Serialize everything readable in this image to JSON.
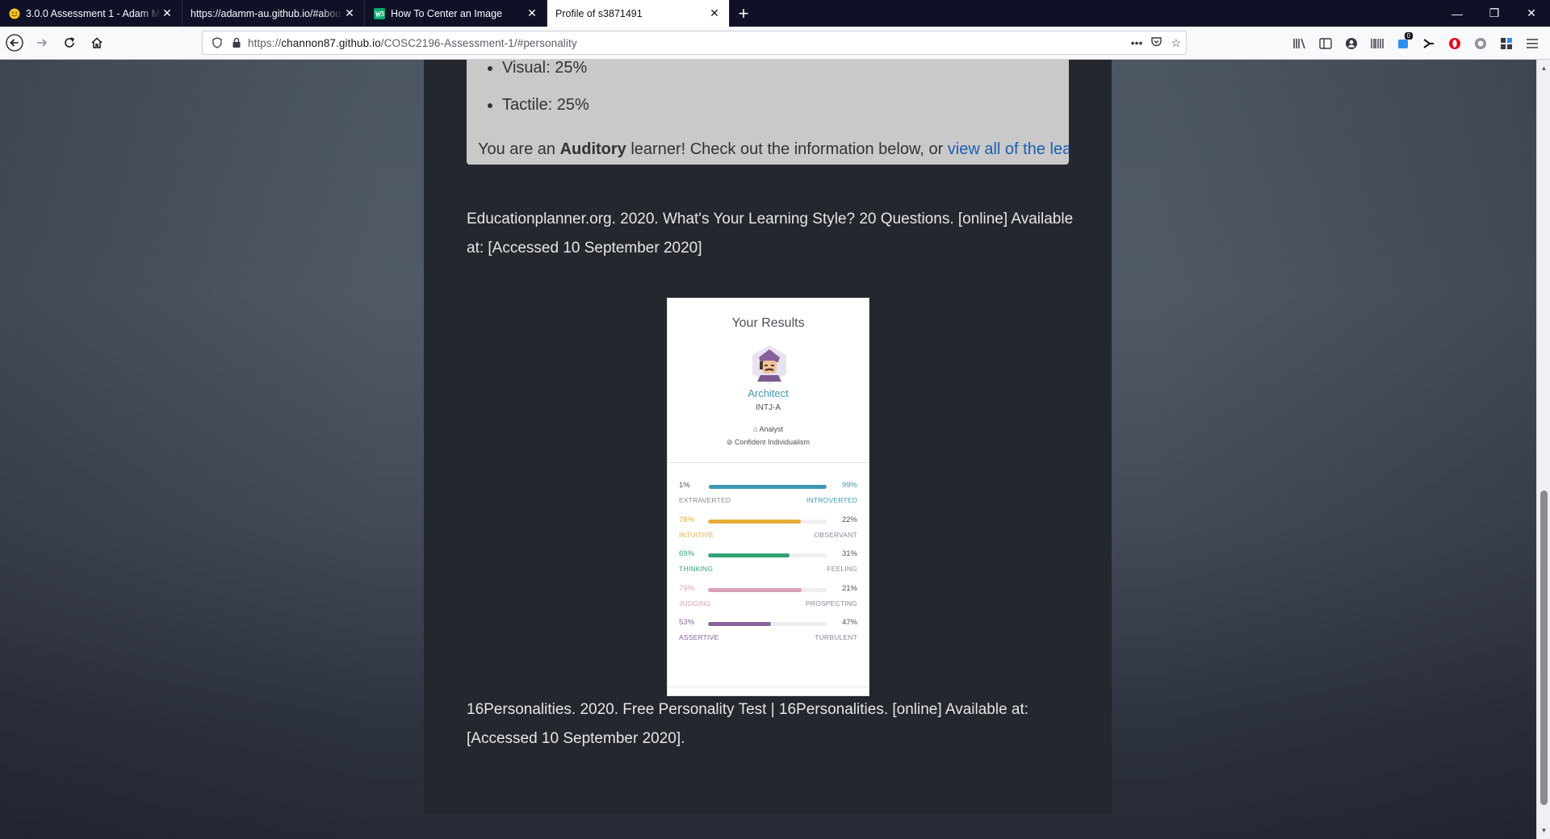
{
  "browser": {
    "tabs": [
      {
        "title": "3.0.0 Assessment 1 - Adam Mu",
        "icon": "emoji-face-icon",
        "active": false
      },
      {
        "title": "https://adamm-au.github.io/#abou",
        "icon": "none",
        "active": false
      },
      {
        "title": "How To Center an Image",
        "icon": "w3-green-icon",
        "active": false
      },
      {
        "title": "Profile of s3871491",
        "icon": "none",
        "active": true
      }
    ],
    "url_prefix": "https://",
    "url_host": "channon87.github.io",
    "url_path": "/COSC2196-Assessment-1/#personality",
    "notification_badge": "0"
  },
  "learning_style": {
    "items": [
      "Visual: 25%",
      "Tactile: 25%"
    ],
    "note_pre": "You are an ",
    "note_bold": "Auditory",
    "note_mid": " learner! Check out the information below, or ",
    "note_link": "view all of the lea"
  },
  "citation1": "Educationplanner.org. 2020. What's Your Learning Style? 20 Questions. [online] Available at: [Accessed 10 September 2020]",
  "personality": {
    "title": "Your Results",
    "type_name": "Architect",
    "type_code": "INTJ-A",
    "role": "Analyst",
    "strategy": "Confident Individualism",
    "traits": [
      {
        "left_pct": "1%",
        "right_pct": "99%",
        "left_label": "EXTRAVERTED",
        "right_label": "INTROVERTED",
        "fill": 0.99,
        "fill_side": "right",
        "color": "#4298b4",
        "dominant": "right"
      },
      {
        "left_pct": "78%",
        "right_pct": "22%",
        "left_label": "INTUITIVE",
        "right_label": "OBSERVANT",
        "fill": 0.78,
        "fill_side": "left",
        "color": "#e4ae3a",
        "dominant": "left"
      },
      {
        "left_pct": "69%",
        "right_pct": "31%",
        "left_label": "THINKING",
        "right_label": "FEELING",
        "fill": 0.69,
        "fill_side": "left",
        "color": "#33a474",
        "dominant": "left"
      },
      {
        "left_pct": "79%",
        "right_pct": "21%",
        "left_label": "JUDGING",
        "right_label": "PROSPECTING",
        "fill": 0.79,
        "fill_side": "left",
        "color": "#d9a0b8",
        "dominant": "left"
      },
      {
        "left_pct": "53%",
        "right_pct": "47%",
        "left_label": "ASSERTIVE",
        "right_label": "TURBULENT",
        "fill": 0.53,
        "fill_side": "left",
        "color": "#88619a",
        "dominant": "left"
      }
    ]
  },
  "citation2": "16Personalities. 2020. Free Personality Test | 16Personalities. [online] Available at: [Accessed 10 September 2020]."
}
